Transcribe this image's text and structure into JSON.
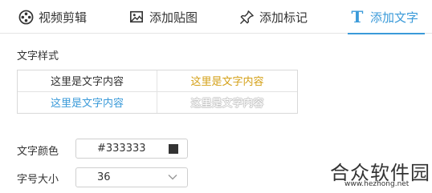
{
  "tabs": [
    {
      "label": "视频剪辑",
      "icon": "film-reel-icon"
    },
    {
      "label": "添加贴图",
      "icon": "image-icon"
    },
    {
      "label": "添加标记",
      "icon": "pin-icon"
    },
    {
      "label": "添加文字",
      "icon": "text-t-icon",
      "glyph": "T",
      "active": true
    }
  ],
  "text_style": {
    "title": "文字样式",
    "options": [
      {
        "text": "这里是文字内容",
        "color": "#333333"
      },
      {
        "text": "这里是文字内容",
        "color": "#d4a017"
      },
      {
        "text": "这里是文字内容",
        "color": "#3a9ad9"
      },
      {
        "text": "这里是文字内容",
        "color": "#c8c8c8"
      }
    ]
  },
  "text_color": {
    "label": "文字颜色",
    "value": "#333333",
    "swatch": "#333333"
  },
  "font_size": {
    "label": "字号大小",
    "value": "36"
  },
  "watermark": {
    "text": "合众软件园",
    "url": "www.hezhong.net"
  },
  "colors": {
    "accent": "#3a9ad9"
  }
}
